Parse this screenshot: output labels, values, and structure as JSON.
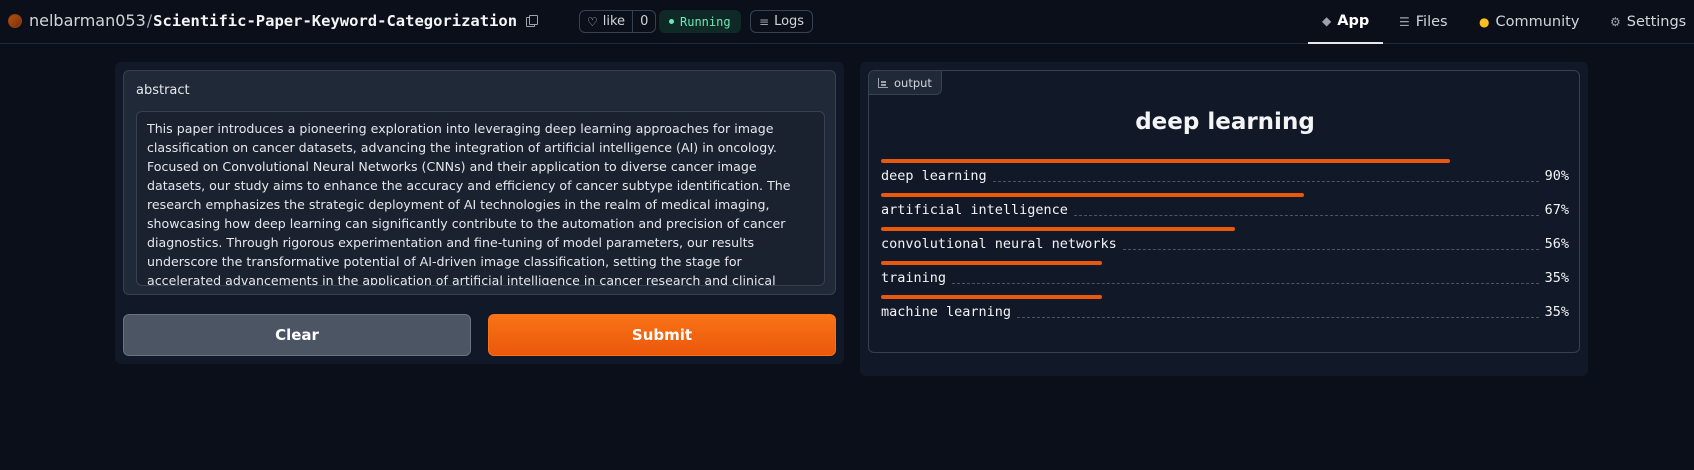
{
  "header": {
    "owner": "nelbarman053",
    "separator": "/",
    "repo": "Scientific-Paper-Keyword-Categorization",
    "like_label": "like",
    "like_count": "0",
    "status": "Running",
    "logs_label": "Logs",
    "nav": [
      {
        "label": "App",
        "icon": "cube-icon"
      },
      {
        "label": "Files",
        "icon": "files-icon"
      },
      {
        "label": "Community",
        "icon": "community-icon"
      },
      {
        "label": "Settings",
        "icon": "gear-icon"
      }
    ]
  },
  "input": {
    "label": "abstract",
    "value": "This paper introduces a pioneering exploration into leveraging deep learning approaches for image classification on cancer datasets, advancing the integration of artificial intelligence (AI) in oncology. Focused on Convolutional Neural Networks (CNNs) and their application to diverse cancer image datasets, our study aims to enhance the accuracy and efficiency of cancer subtype identification. The research emphasizes the strategic deployment of AI technologies in the realm of medical imaging, showcasing how deep learning can significantly contribute to the automation and precision of cancer diagnostics. Through rigorous experimentation and fine-tuning of model parameters, our results underscore the transformative potential of AI-driven image classification, setting the stage for accelerated advancements in the application of artificial intelligence in cancer research and clinical practice."
  },
  "buttons": {
    "clear": "Clear",
    "submit": "Submit"
  },
  "output": {
    "tag": "output",
    "title": "deep learning",
    "confidences": [
      {
        "label": "deep learning",
        "pct": "90%",
        "value": 0.9
      },
      {
        "label": "artificial intelligence",
        "pct": "67%",
        "value": 0.67
      },
      {
        "label": "convolutional neural networks",
        "pct": "56%",
        "value": 0.56
      },
      {
        "label": "training",
        "pct": "35%",
        "value": 0.35
      },
      {
        "label": "machine learning",
        "pct": "35%",
        "value": 0.35
      }
    ]
  },
  "colors": {
    "accent": "#ea580c",
    "background": "#0b0f19",
    "status": "#6ee7b7"
  }
}
